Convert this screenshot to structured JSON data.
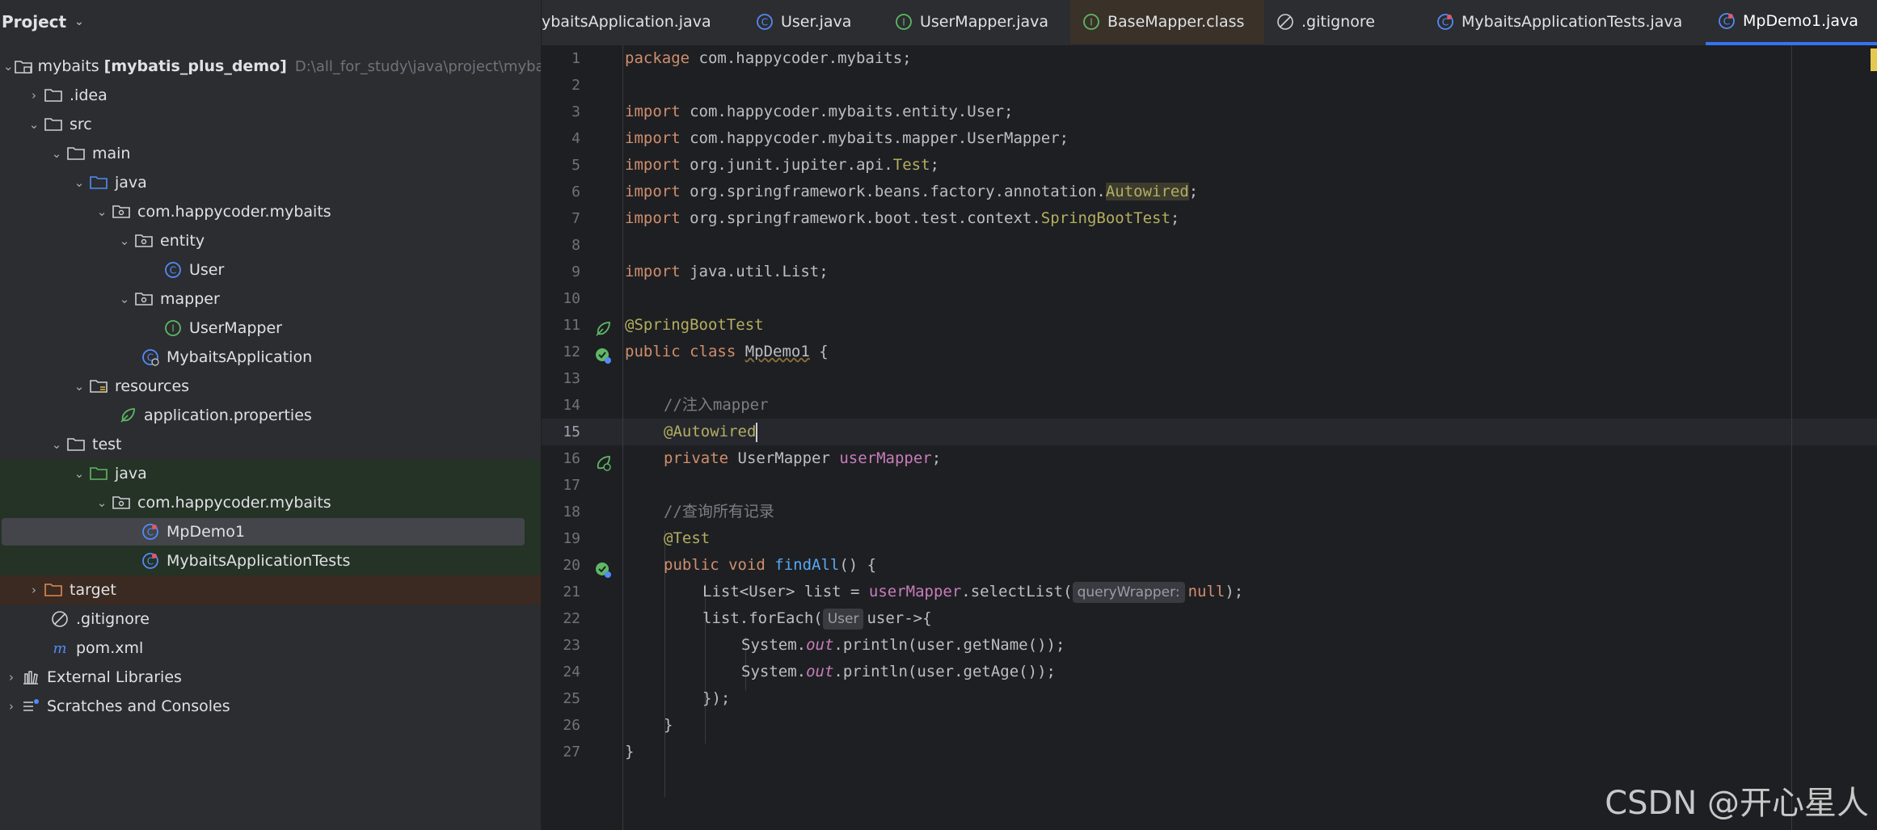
{
  "project_panel": {
    "title": "Project",
    "tree": [
      {
        "label": "mybaits",
        "extra": "[mybatis_plus_demo]",
        "path": "D:\\all_for_study\\java\\project\\mybaits",
        "icon": "module-folder-icon",
        "expanded": true
      },
      {
        "label": ".idea",
        "icon": "folder-icon",
        "expanded": false
      },
      {
        "label": "src",
        "icon": "folder-icon",
        "expanded": true
      },
      {
        "label": "main",
        "icon": "folder-icon",
        "expanded": true
      },
      {
        "label": "java",
        "icon": "source-root-folder-icon",
        "expanded": true
      },
      {
        "label": "com.happycoder.mybaits",
        "icon": "package-icon",
        "expanded": true
      },
      {
        "label": "entity",
        "icon": "package-icon",
        "expanded": true
      },
      {
        "label": "User",
        "icon": "class-icon"
      },
      {
        "label": "mapper",
        "icon": "package-icon",
        "expanded": true
      },
      {
        "label": "UserMapper",
        "icon": "interface-icon"
      },
      {
        "label": "MybaitsApplication",
        "icon": "spring-boot-class-icon"
      },
      {
        "label": "resources",
        "icon": "resources-folder-icon",
        "expanded": true
      },
      {
        "label": "application.properties",
        "icon": "spring-properties-icon"
      },
      {
        "label": "test",
        "icon": "folder-icon",
        "expanded": true
      },
      {
        "label": "java",
        "icon": "test-root-folder-icon",
        "expanded": true
      },
      {
        "label": "com.happycoder.mybaits",
        "icon": "package-icon",
        "expanded": true
      },
      {
        "label": "MpDemo1",
        "icon": "test-class-icon"
      },
      {
        "label": "MybaitsApplicationTests",
        "icon": "test-class-icon"
      },
      {
        "label": "target",
        "icon": "excluded-folder-icon",
        "expanded": false
      },
      {
        "label": ".gitignore",
        "icon": "ignore-file-icon"
      },
      {
        "label": "pom.xml",
        "icon": "maven-icon"
      },
      {
        "label": "External Libraries",
        "icon": "libraries-icon",
        "expanded": false
      },
      {
        "label": "Scratches and Consoles",
        "icon": "scratches-icon",
        "expanded": false
      }
    ]
  },
  "tabs": [
    {
      "label": "ybaitsApplication.java",
      "icon": ""
    },
    {
      "label": "User.java",
      "icon": "class-icon"
    },
    {
      "label": "UserMapper.java",
      "icon": "interface-icon"
    },
    {
      "label": "BaseMapper.class",
      "icon": "interface-icon"
    },
    {
      "label": ".gitignore",
      "icon": "ignore-file-icon"
    },
    {
      "label": "MybaitsApplicationTests.java",
      "icon": "test-class-icon"
    },
    {
      "label": "MpDemo1.java",
      "icon": "test-class-icon",
      "active": true
    }
  ],
  "editor": {
    "current_line": 15,
    "line_numbers": [
      "1",
      "2",
      "3",
      "4",
      "5",
      "6",
      "7",
      "8",
      "9",
      "10",
      "11",
      "12",
      "13",
      "14",
      "15",
      "16",
      "17",
      "18",
      "19",
      "20",
      "21",
      "22",
      "23",
      "24",
      "25",
      "26",
      "27"
    ],
    "code": {
      "l1_kw": "package",
      "l1_rest": " com.happycoder.mybaits;",
      "l3_kw": "import",
      "l3_rest": " com.happycoder.mybaits.entity.User;",
      "l4_kw": "import",
      "l4_rest": " com.happycoder.mybaits.mapper.UserMapper;",
      "l5_kw": "import",
      "l5_rest": " org.junit.jupiter.api.",
      "l5_ann": "Test",
      "l5_end": ";",
      "l6_kw": "import",
      "l6_rest": " org.springframework.beans.factory.annotation.",
      "l6_ann": "Autowired",
      "l6_end": ";",
      "l7_kw": "import",
      "l7_rest": " org.springframework.boot.test.context.",
      "l7_ann": "SpringBootTest",
      "l7_end": ";",
      "l9_kw": "import",
      "l9_rest": " java.util.List;",
      "l11_ann": "@SpringBootTest",
      "l12_kw": "public class ",
      "l12_cls": "MpDemo1",
      "l12_end": " {",
      "l14_cm": "//注入mapper",
      "l15_ann": "@Autowired",
      "l16_kw": "private ",
      "l16_type": "UserMapper ",
      "l16_fld": "userMapper",
      "l16_end": ";",
      "l18_cm": "//查询所有记录",
      "l19_ann": "@Test",
      "l20_kw": "public void ",
      "l20_fn": "findAll",
      "l20_end": "() {",
      "l21_a": "List<User> list = ",
      "l21_fld": "userMapper",
      "l21_b": ".selectList(",
      "l21_hint": "queryWrapper:",
      "l21_kw": "null",
      "l21_end": ");",
      "l22_a": "list.forEach(",
      "l22_hint": "User",
      "l22_b": "user->{",
      "l23_a": "System.",
      "l23_i": "out",
      "l23_b": ".println(user.getName());",
      "l24_a": "System.",
      "l24_i": "out",
      "l24_b": ".println(user.getAge());",
      "l25": "});",
      "l26": "}",
      "l27": "}"
    }
  },
  "watermark": "CSDN @开心星人",
  "colors": {
    "accent": "#3574f0",
    "keyword": "#cf8e6d",
    "annotation": "#b3ae60",
    "field": "#c77dbb",
    "method": "#56a8f5",
    "comment": "#7a7e85"
  }
}
